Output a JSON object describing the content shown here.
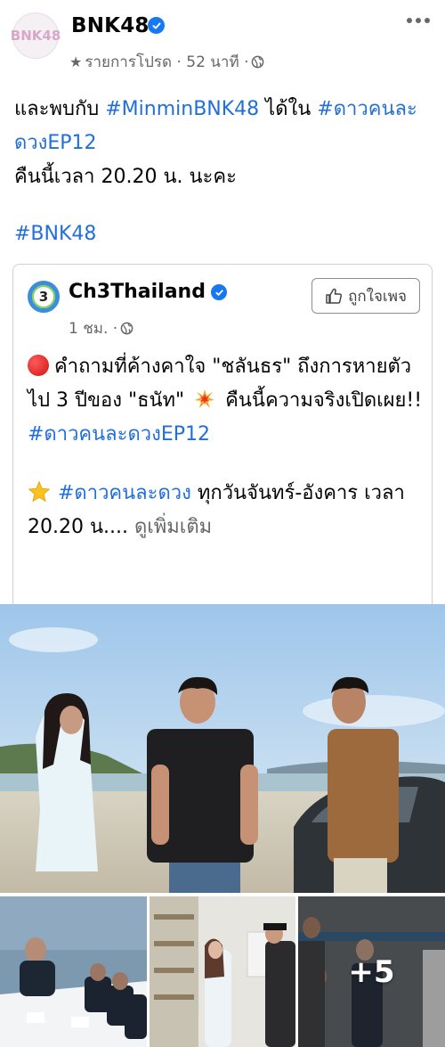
{
  "post": {
    "page_name": "BNK48",
    "avatar_text": "BNK48",
    "meta": "รายการโปรด · 52 นาที ·",
    "text_prefix": "และพบกับ ",
    "tag1": "#MinminBNK48",
    "text_mid": " ได้ใน ",
    "tag2": "#ดาวคนละดวงEP12",
    "text_line3": "คืนนี้เวลา 20.20 น. นะคะ",
    "hashtag": "#BNK48"
  },
  "shared": {
    "page_name": "Ch3Thailand",
    "logo_text": "3",
    "meta": "1 ชม. ·",
    "like_label": "ถูกใจเพจ",
    "text1": "คำถามที่ค้างคาใจ \"ชลันธร\" ถึงการหายตัวไป 3 ปีของ \"ธนัท\"",
    "text2": " คืนนี้ความจริงเปิดเผย!! ",
    "tag1": "#ดาวคนละดวงEP12",
    "tag2": "#ดาวคนละดวง",
    "text3": " ทุกวันจันทร์-อังคาร เวลา 20.20 น.... ",
    "see_more": "ดูเพิ่มเติม"
  },
  "photos": {
    "more_count": "+5"
  },
  "colors": {
    "link": "#216fdb",
    "verified": "#1877f2",
    "muted": "#65676b"
  },
  "icons": [
    "verified-badge-icon",
    "star-icon",
    "globe-icon",
    "more-options-icon",
    "thumbs-up-icon",
    "red-circle-icon",
    "collision-icon",
    "star-emoji-icon"
  ]
}
